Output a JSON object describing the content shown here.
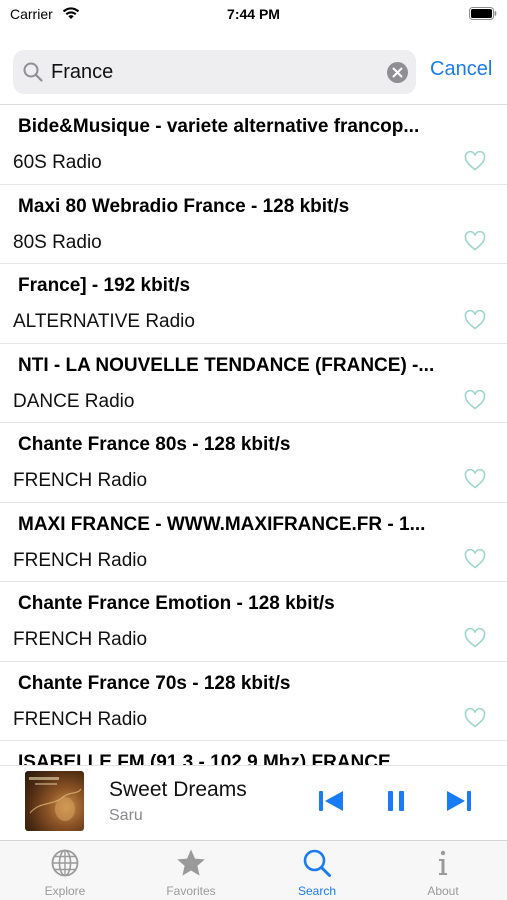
{
  "status_bar": {
    "carrier": "Carrier",
    "time": "7:44 PM"
  },
  "search": {
    "value": "France",
    "cancel_label": "Cancel"
  },
  "stations": [
    {
      "title": "Bide&Musique - variete alternative francop...",
      "genre": "60S Radio"
    },
    {
      "title": "Maxi 80 Webradio France - 128 kbit/s",
      "genre": "80S Radio"
    },
    {
      "title": "France] - 192 kbit/s",
      "genre": "ALTERNATIVE Radio"
    },
    {
      "title": "NTI - LA NOUVELLE TENDANCE (FRANCE) -...",
      "genre": "DANCE Radio"
    },
    {
      "title": "Chante France 80s - 128 kbit/s",
      "genre": "FRENCH Radio"
    },
    {
      "title": "MAXI FRANCE - WWW.MAXIFRANCE.FR - 1...",
      "genre": "FRENCH Radio"
    },
    {
      "title": "Chante France Emotion - 128 kbit/s",
      "genre": "FRENCH Radio"
    },
    {
      "title": "Chante France 70s - 128 kbit/s",
      "genre": "FRENCH Radio"
    },
    {
      "title": "ISABELLE FM (91.3 - 102.9 Mhz) FRANCE",
      "genre": ""
    }
  ],
  "now_playing": {
    "title": "Sweet Dreams",
    "artist": "Saru"
  },
  "tabs": [
    {
      "label": "Explore",
      "icon": "globe-icon"
    },
    {
      "label": "Favorites",
      "icon": "star-icon"
    },
    {
      "label": "Search",
      "icon": "search-icon"
    },
    {
      "label": "About",
      "icon": "info-icon"
    }
  ],
  "colors": {
    "accent": "#1a7cf4",
    "heart": "#9fd6cc"
  }
}
